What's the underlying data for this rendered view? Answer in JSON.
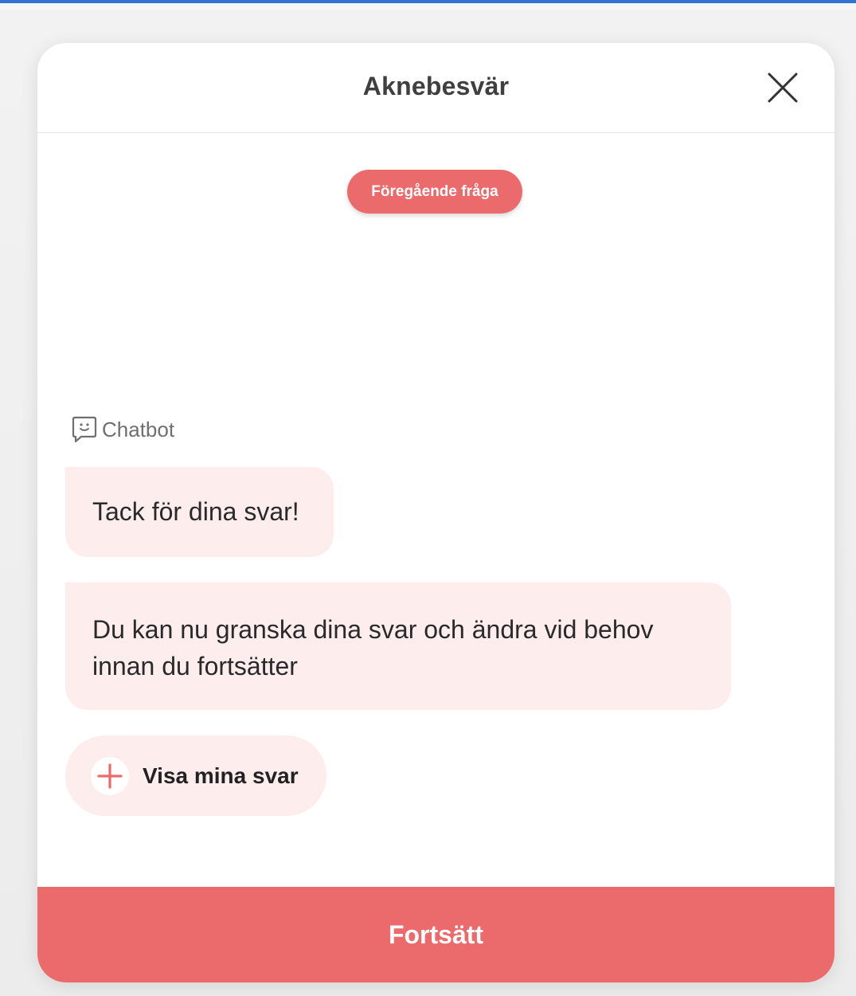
{
  "modal": {
    "title": "Aknebesvär",
    "close_icon": "close-icon"
  },
  "navigation": {
    "previous_label": "Föregående fråga"
  },
  "chat": {
    "sender_label": "Chatbot",
    "sender_icon": "chat-smiley-icon",
    "messages": [
      {
        "text": "Tack för dina svar!"
      },
      {
        "text": "Du kan nu granska dina svar och ändra vid behov innan du fortsätter"
      }
    ],
    "show_answers_label": "Visa mina svar",
    "show_answers_icon": "plus-icon"
  },
  "footer": {
    "continue_label": "Fortsätt"
  },
  "colors": {
    "accent": "#eb6a6c",
    "bubble_background": "#fdeded",
    "top_bar": "#2f73d0"
  }
}
